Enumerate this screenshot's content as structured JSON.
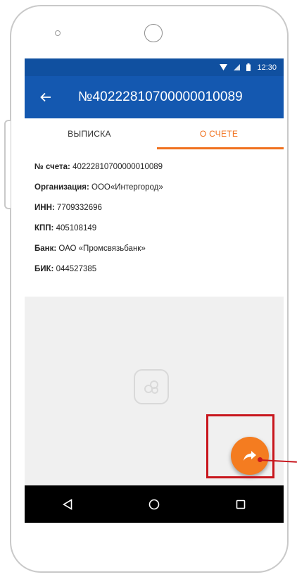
{
  "statusbar": {
    "time": "12:30"
  },
  "appbar": {
    "title": "№40222810700000010089"
  },
  "tabs": [
    {
      "label": "ВЫПИСКА",
      "active": false
    },
    {
      "label": "О СЧЕТЕ",
      "active": true
    }
  ],
  "details": [
    {
      "label": "№ счета:",
      "value": "40222810700000010089"
    },
    {
      "label": "Организация:",
      "value": "ООО«Интергород»"
    },
    {
      "label": "ИНН:",
      "value": "7709332696"
    },
    {
      "label": "КПП:",
      "value": "405108149"
    },
    {
      "label": "Банк:",
      "value": "ОАО «Промсвязьбанк»"
    },
    {
      "label": "БИК:",
      "value": "044527385"
    }
  ],
  "colors": {
    "primary": "#1458b0",
    "statusbar": "#1050a0",
    "accent": "#f0711e",
    "fab": "#f47c20",
    "annotation": "#c8161d"
  },
  "icons": {
    "back": "arrow-left-icon",
    "fab": "share-forward-icon",
    "nav_back": "triangle-back-icon",
    "nav_home": "circle-home-icon",
    "nav_recent": "square-recent-icon"
  }
}
